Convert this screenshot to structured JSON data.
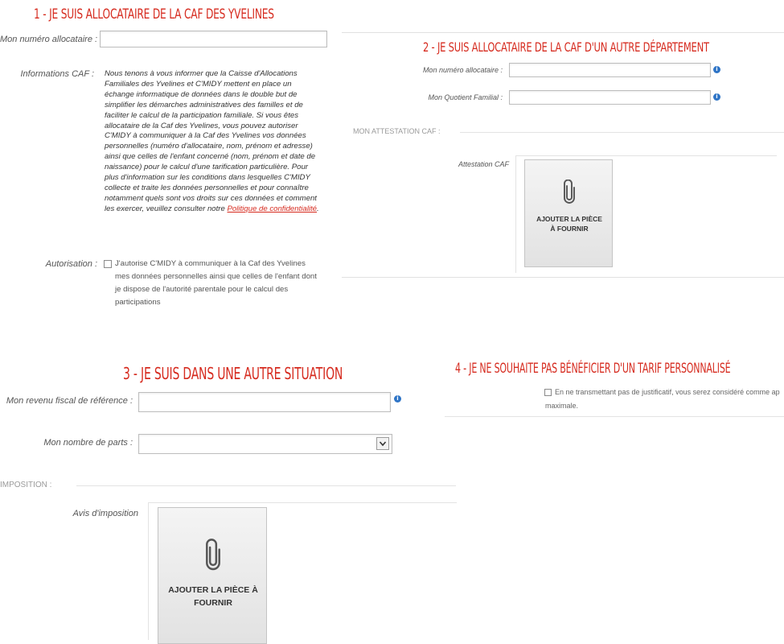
{
  "section1": {
    "title": "1 - JE SUIS ALLOCATAIRE DE LA CAF DES YVELINES",
    "numero_label": "Mon numéro allocataire :",
    "numero_value": "",
    "info_label": "Informations CAF :",
    "info_text": "Nous tenons à vous informer que la Caisse d'Allocations Familiales des Yvelines et C'MIDY mettent en place un échange informatique de données dans le double but de simplifier les démarches administratives des familles et de faciliter le calcul de la participation familiale. Si vous êtes allocataire de la Caf des Yvelines, vous pouvez autoriser C'MIDY à communiquer à la Caf des Yvelines vos données personnelles (numéro d'allocataire, nom, prénom et adresse) ainsi que celles de l'enfant concerné (nom, prénom et date de naissance) pour le calcul d'une tarification particulière. Pour plus d'information sur les conditions dans lesquelles C'MIDY collecte et traite les données personnelles et pour connaître notamment quels sont vos droits sur ces données et comment les exercer, veuillez consulter notre",
    "policy_link": "Politique de confidentialité",
    "info_end": ".",
    "autorisation_label": "Autorisation :",
    "autorisation_text": "J'autorise C'MIDY à communiquer à la Caf des Yvelines mes données personnelles ainsi que celles de l'enfant dont je dispose de l'autorité parentale pour le calcul des participations"
  },
  "section2": {
    "title": "2 - JE SUIS ALLOCATAIRE DE LA CAF D'UN AUTRE DÉPARTEMENT",
    "numero_label": "Mon numéro allocataire :",
    "numero_value": "",
    "quotient_label": "Mon Quotient Familial :",
    "quotient_value": "",
    "attestation_header": "MON ATTESTATION CAF :",
    "attestation_label": "Attestation CAF",
    "upload_label": "AJOUTER LA PIÈCE À FOURNIR"
  },
  "section3": {
    "title": "3 - JE SUIS DANS UNE AUTRE SITUATION",
    "revenu_label": "Mon revenu fiscal de référence :",
    "revenu_value": "",
    "parts_label": "Mon nombre de parts :",
    "parts_selected": "",
    "imposition_header": "IMPOSITION :",
    "avis_label": "Avis d'imposition",
    "upload_label": "AJOUTER LA PIÈCE À FOURNIR"
  },
  "section4": {
    "title": "4 - JE NE SOUHAITE PAS BÉNÉFICIER D'UN TARIF PERSONNALISÉ",
    "checkbox_text": "En ne transmettant pas de justificatif, vous serez considéré comme ap",
    "checkbox_text_line2": "maximale."
  },
  "icons": {
    "info": "info-icon",
    "attachment": "paperclip-icon",
    "select_arrow": "chevron-down-icon"
  },
  "colors": {
    "title_red": "#d62b1f",
    "info_blue": "#2e74c6",
    "link_red": "#d62b1f"
  }
}
